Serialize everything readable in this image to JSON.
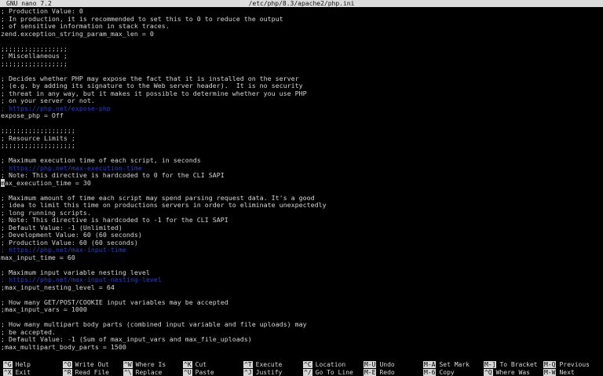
{
  "titlebar": {
    "app": "GNU nano 7.2",
    "file": "/etc/php/8.3/apache2/php.ini"
  },
  "lines": [
    {
      "text": "; Production Value: 0",
      "type": "text"
    },
    {
      "text": "; In production, it is recommended to set this to 0 to reduce the output",
      "type": "text"
    },
    {
      "text": "; of sensitive information in stack traces.",
      "type": "text"
    },
    {
      "text": "zend.exception_string_param_max_len = 0",
      "type": "text"
    },
    {
      "text": "",
      "type": "text"
    },
    {
      "text": ";;;;;;;;;;;;;;;;;",
      "type": "text"
    },
    {
      "text": "; Miscellaneous ;",
      "type": "text"
    },
    {
      "text": ";;;;;;;;;;;;;;;;;",
      "type": "text"
    },
    {
      "text": "",
      "type": "text"
    },
    {
      "text": "; Decides whether PHP may expose the fact that it is installed on the server",
      "type": "text"
    },
    {
      "text": "; (e.g. by adding its signature to the Web server header).  It is no security",
      "type": "text"
    },
    {
      "text": "; threat in any way, but it makes it possible to determine whether you use PHP",
      "type": "text"
    },
    {
      "text": "; on your server or not.",
      "type": "text"
    },
    {
      "text": "; https://php.net/expose-php",
      "type": "url"
    },
    {
      "text": "expose_php = Off",
      "type": "text"
    },
    {
      "text": "",
      "type": "text"
    },
    {
      "text": ";;;;;;;;;;;;;;;;;;;",
      "type": "text"
    },
    {
      "text": "; Resource Limits ;",
      "type": "text"
    },
    {
      "text": ";;;;;;;;;;;;;;;;;;;",
      "type": "text"
    },
    {
      "text": "",
      "type": "text"
    },
    {
      "text": "; Maximum execution time of each script, in seconds",
      "type": "text"
    },
    {
      "text": "; https://php.net/max-execution-time",
      "type": "url"
    },
    {
      "text": "; Note: This directive is hardcoded to 0 for the CLI SAPI",
      "type": "text"
    },
    {
      "text": "max_execution_time = 30",
      "type": "cursor"
    },
    {
      "text": "",
      "type": "text"
    },
    {
      "text": "; Maximum amount of time each script may spend parsing request data. It's a good",
      "type": "text"
    },
    {
      "text": "; idea to limit this time on productions servers in order to eliminate unexpectedly",
      "type": "text"
    },
    {
      "text": "; long running scripts.",
      "type": "text"
    },
    {
      "text": "; Note: This directive is hardcoded to -1 for the CLI SAPI",
      "type": "text"
    },
    {
      "text": "; Default Value: -1 (Unlimited)",
      "type": "text"
    },
    {
      "text": "; Development Value: 60 (60 seconds)",
      "type": "text"
    },
    {
      "text": "; Production Value: 60 (60 seconds)",
      "type": "text"
    },
    {
      "text": "; https://php.net/max-input-time",
      "type": "url"
    },
    {
      "text": "max_input_time = 60",
      "type": "text"
    },
    {
      "text": "",
      "type": "text"
    },
    {
      "text": "; Maximum input variable nesting level",
      "type": "text"
    },
    {
      "text": "; https://php.net/max-input-nesting-level",
      "type": "url"
    },
    {
      "text": ";max_input_nesting_level = 64",
      "type": "text"
    },
    {
      "text": "",
      "type": "text"
    },
    {
      "text": "; How many GET/POST/COOKIE input variables may be accepted",
      "type": "text"
    },
    {
      "text": ";max_input_vars = 1000",
      "type": "text"
    },
    {
      "text": "",
      "type": "text"
    },
    {
      "text": "; How many multipart body parts (combined input variable and file uploads) may",
      "type": "text"
    },
    {
      "text": "; be accepted.",
      "type": "text"
    },
    {
      "text": "; Default Value: -1 (Sum of max_input_vars and max_file_uploads)",
      "type": "text"
    },
    {
      "text": ";max_multipart_body_parts = 1500",
      "type": "text"
    }
  ],
  "shortcuts": [
    {
      "key": "^G",
      "label": "Help"
    },
    {
      "key": "^X",
      "label": "Exit"
    },
    {
      "key": "^O",
      "label": "Write Out"
    },
    {
      "key": "^R",
      "label": "Read File"
    },
    {
      "key": "^W",
      "label": "Where Is"
    },
    {
      "key": "^\\",
      "label": "Replace"
    },
    {
      "key": "^K",
      "label": "Cut"
    },
    {
      "key": "^U",
      "label": "Paste"
    },
    {
      "key": "^T",
      "label": "Execute"
    },
    {
      "key": "^J",
      "label": "Justify"
    },
    {
      "key": "^C",
      "label": "Location"
    },
    {
      "key": "^/",
      "label": "Go To Line"
    },
    {
      "key": "M-U",
      "label": "Undo"
    },
    {
      "key": "M-E",
      "label": "Redo"
    },
    {
      "key": "M-A",
      "label": "Set Mark"
    },
    {
      "key": "M-6",
      "label": "Copy"
    },
    {
      "key": "M-]",
      "label": "To Bracket"
    },
    {
      "key": "^Q",
      "label": "Where Was"
    },
    {
      "key": "M-Q",
      "label": "Previous"
    },
    {
      "key": "M-W",
      "label": "Next"
    }
  ]
}
